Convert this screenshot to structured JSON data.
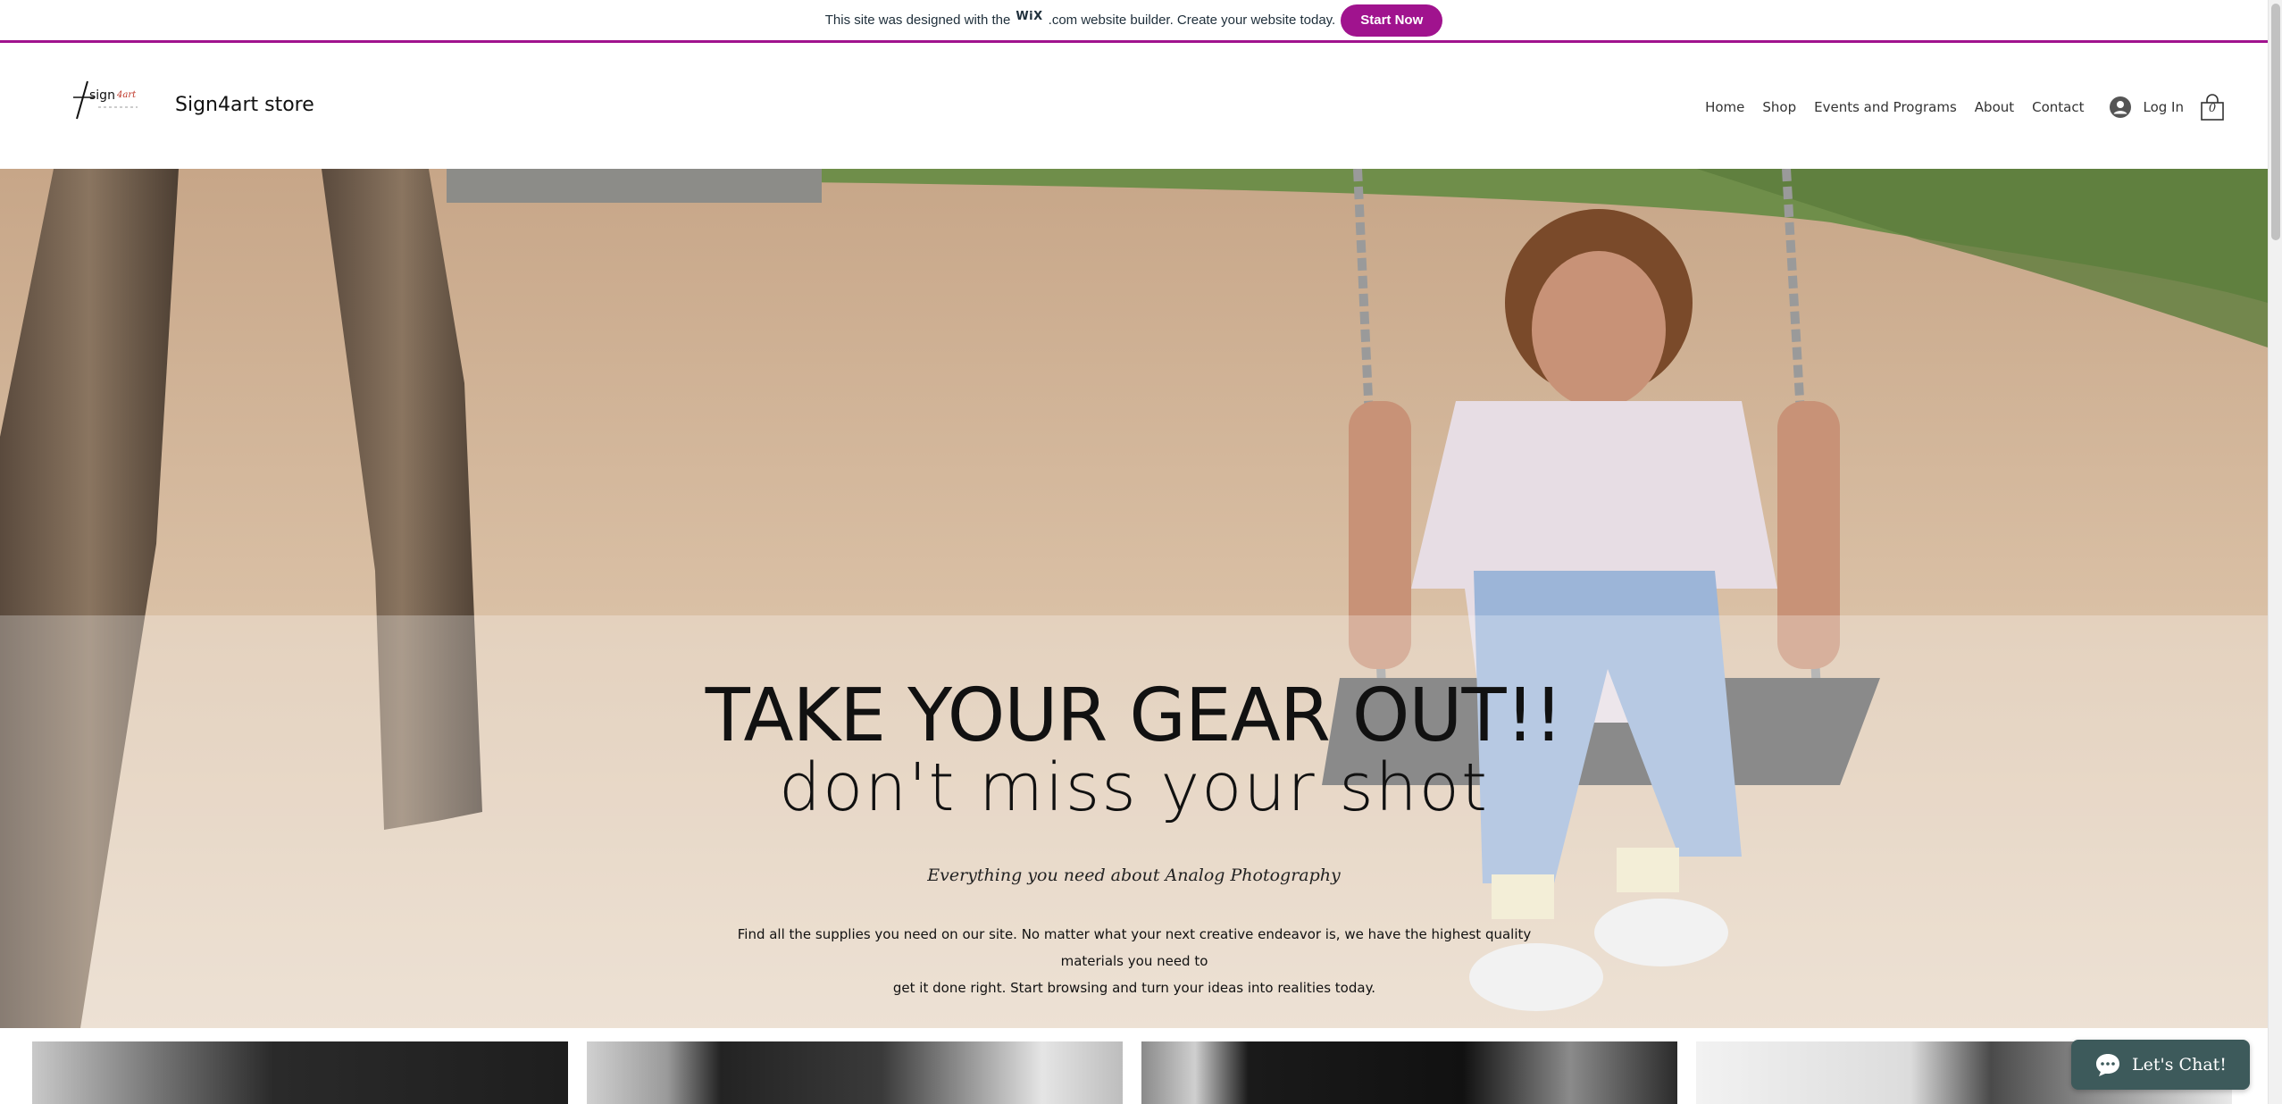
{
  "banner": {
    "text_before": "This site was designed with the",
    "wix_logo": "WiX",
    "text_after": ".com website builder. Create your website today.",
    "cta_label": "Start Now",
    "accent_color": "#a0138e"
  },
  "header": {
    "logo_text": "sign4art",
    "store_name": "Sign4art store",
    "nav": [
      {
        "label": "Home"
      },
      {
        "label": "Shop"
      },
      {
        "label": "Events and Programs"
      },
      {
        "label": "About"
      },
      {
        "label": "Contact"
      }
    ],
    "login_label": "Log In",
    "cart_count": "0"
  },
  "hero": {
    "headline_1": "TAKE YOUR GEAR OUT!!",
    "headline_2": "don't miss your shot",
    "tagline": "Everything you need about Analog Photography",
    "intro_line_1": "Find all the supplies you need on our site. No matter what your next creative endeavor is, we have the highest quality materials you need to",
    "intro_line_2": "get it done right. Start browsing and turn your ideas into realities today."
  },
  "chat": {
    "label": "Let's Chat!",
    "color": "#3d5a5b"
  },
  "icons": [
    "user-icon",
    "cart-icon",
    "chat-bubble-icon"
  ]
}
